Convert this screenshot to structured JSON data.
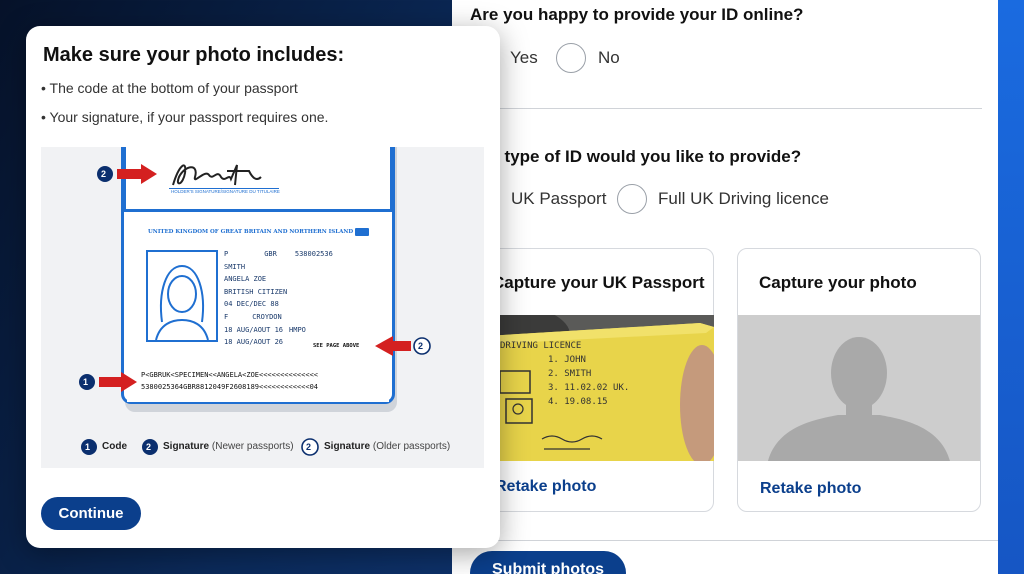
{
  "form": {
    "q_online": "Are you happy to provide your ID online?",
    "opt_yes": "Yes",
    "opt_no": "No",
    "q_type": "ch type of ID would you like to provide?",
    "opt_passport": "UK Passport",
    "opt_licence": "Full UK Driving licence",
    "card_passport_title": "Capture your UK Passport",
    "card_photo_title": "Capture your photo",
    "retake_label": "Retake photo",
    "submit_label": "Submit photos"
  },
  "modal": {
    "title": "Make sure your photo includes:",
    "bullets": [
      "• The code at the bottom of your passport",
      "• Your signature, if your passport requires one."
    ],
    "continue_label": "Continue",
    "passport": {
      "holder_sig_label": "HOLDER'S SIGNATURE/SIGNATURE DU TITULAIRE",
      "country": "UNITED KINGDOM OF GREAT BRITAIN AND NORTHERN ISLAND",
      "type": "P",
      "code": "GBR",
      "number": "538002536",
      "surname": "SMITH",
      "given": "ANGELA  ZOE",
      "nationality": "BRITISH CITIZEN",
      "dob": "04 DEC/DEC 88",
      "sex": "F",
      "place": "CROYDON",
      "issue": "18 AUG/AOUT 16",
      "authority": "HMPO",
      "expiry": "18 AUG/AOUT 26",
      "see_page": "SEE PAGE ABOVE",
      "mrz1": "P<GBRUK<SPECIMEN<<ANGELA<ZOE<<<<<<<<<<<<<<",
      "mrz2": "5380025364GBR8812049F2608189<<<<<<<<<<<<04"
    },
    "legend": {
      "n1": "1",
      "code": "Code",
      "n2": "2",
      "sig_new": "Signature",
      "sig_new_note": "(Newer passports)",
      "n3": "2",
      "sig_old": "Signature",
      "sig_old_note": "(Older passports)"
    },
    "licence_note": {
      "line1": "DRIVING  LICENCE",
      "line2": "1. JOHN",
      "line3": "2. SMITH",
      "line4": "3. 11.02.02  UK.",
      "line5": "4. 19.08.15",
      "badge": "UK"
    }
  },
  "colors": {
    "brand": "#0b3f8c",
    "arrow": "#d42020",
    "badge": "#0b2f6e"
  }
}
